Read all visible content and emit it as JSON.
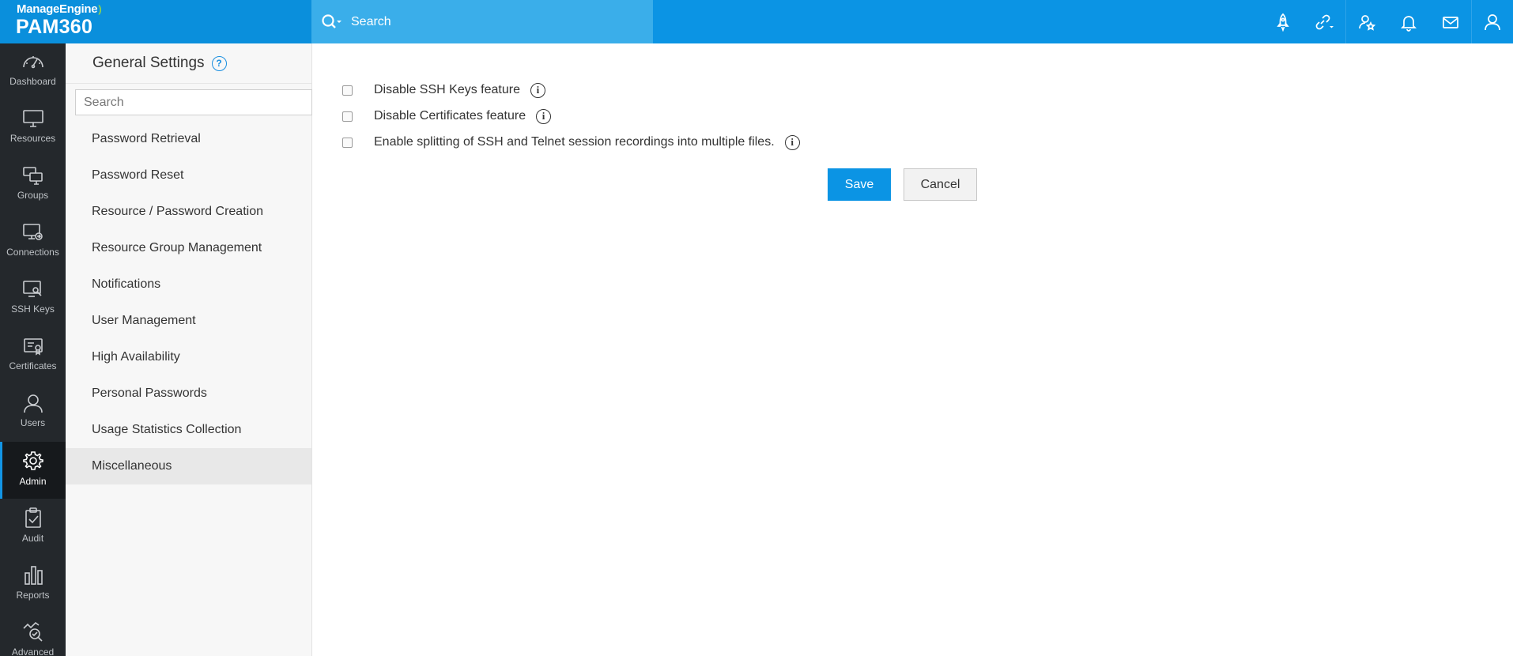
{
  "brand": {
    "vendor": "ManageEngine",
    "product": "PAM360"
  },
  "search": {
    "placeholder": "Search"
  },
  "top_icons": [
    "rocket-icon",
    "link-icon",
    "user-star-icon",
    "bell-icon",
    "mail-icon",
    "user-icon"
  ],
  "nav": {
    "items": [
      {
        "label": "Dashboard",
        "icon": "dashboard-icon"
      },
      {
        "label": "Resources",
        "icon": "monitor-icon"
      },
      {
        "label": "Groups",
        "icon": "groups-icon"
      },
      {
        "label": "Connections",
        "icon": "connections-icon"
      },
      {
        "label": "SSH Keys",
        "icon": "ssh-keys-icon"
      },
      {
        "label": "Certificates",
        "icon": "certificate-icon"
      },
      {
        "label": "Users",
        "icon": "users-icon"
      },
      {
        "label": "Admin",
        "icon": "gear-icon",
        "active": true
      },
      {
        "label": "Audit",
        "icon": "clipboard-icon"
      },
      {
        "label": "Reports",
        "icon": "bar-chart-icon"
      },
      {
        "label": "Advanced",
        "icon": "analytics-icon"
      }
    ]
  },
  "settings_panel": {
    "title": "General Settings",
    "help": "?",
    "search_placeholder": "Search",
    "items": [
      {
        "label": "Password Retrieval"
      },
      {
        "label": "Password Reset"
      },
      {
        "label": "Resource / Password Creation"
      },
      {
        "label": "Resource Group Management"
      },
      {
        "label": "Notifications"
      },
      {
        "label": "User Management"
      },
      {
        "label": "High Availability"
      },
      {
        "label": "Personal Passwords"
      },
      {
        "label": "Usage Statistics Collection"
      },
      {
        "label": "Miscellaneous",
        "active": true
      }
    ]
  },
  "options": [
    {
      "label": "Disable SSH Keys feature",
      "checked": false
    },
    {
      "label": "Disable Certificates feature",
      "checked": false
    },
    {
      "label": "Enable splitting of SSH and Telnet session recordings into multiple files.",
      "checked": false
    }
  ],
  "info_glyph": "i",
  "actions": {
    "save": "Save",
    "cancel": "Cancel"
  },
  "colors": {
    "topbar": "#0b94e4",
    "search_bg": "#3aaeea",
    "nav_bg": "#24282c",
    "accent": "#1295e5"
  }
}
